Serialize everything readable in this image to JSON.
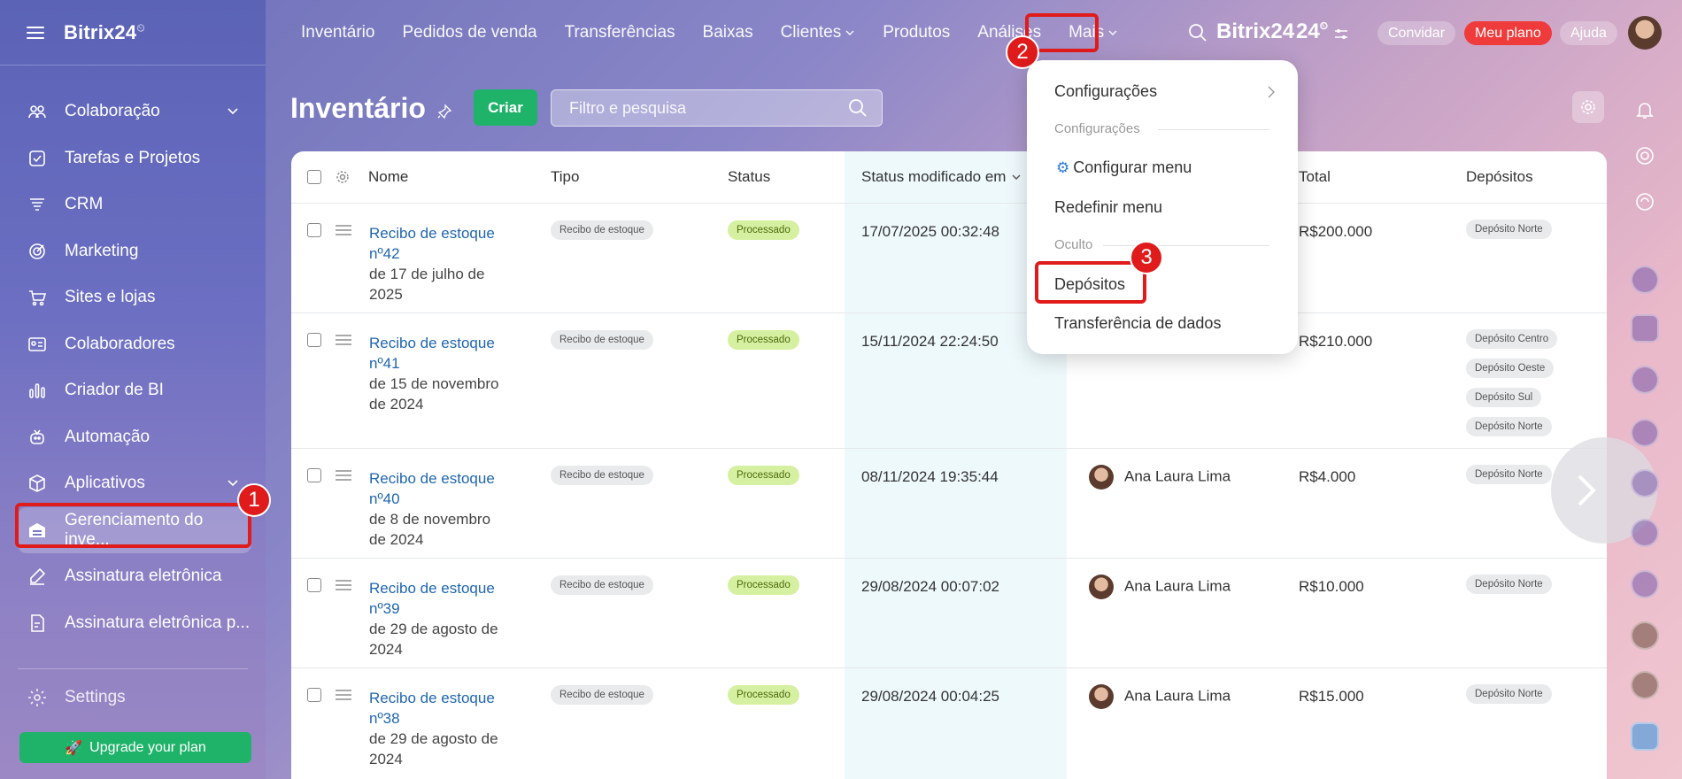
{
  "app": {
    "logo": "Bitrix24",
    "logo_mark": "⏲",
    "brand": "Bitrix24",
    "brand_num": "24"
  },
  "sidebar": {
    "items": [
      {
        "label": "Colaboração",
        "icon": "collaboration-icon",
        "chevron": true
      },
      {
        "label": "Tarefas e Projetos",
        "icon": "tasks-icon"
      },
      {
        "label": "CRM",
        "icon": "crm-icon"
      },
      {
        "label": "Marketing",
        "icon": "marketing-icon"
      },
      {
        "label": "Sites e lojas",
        "icon": "cart-icon"
      },
      {
        "label": "Colaboradores",
        "icon": "employees-icon"
      },
      {
        "label": "Criador de BI",
        "icon": "bi-chart-icon"
      },
      {
        "label": "Automação",
        "icon": "automation-icon"
      },
      {
        "label": "Aplicativos",
        "icon": "apps-icon",
        "chevron": true
      },
      {
        "label": "Gerenciamento do inve...",
        "icon": "inventory-icon"
      },
      {
        "label": "Assinatura eletrônica",
        "icon": "signature-icon"
      },
      {
        "label": "Assinatura eletrônica p...",
        "icon": "signature-doc-icon"
      }
    ],
    "settings_label": "Settings",
    "upgrade_label": "Upgrade your plan"
  },
  "topnav": {
    "items": [
      "Inventário",
      "Pedidos de venda",
      "Transferências",
      "Baixas",
      "Clientes",
      "Produtos",
      "Análises",
      "Mais"
    ],
    "invite": "Convidar",
    "plan": "Meu plano",
    "help": "Ajuda"
  },
  "annotations": {
    "one": "1",
    "two": "2",
    "three": "3"
  },
  "page": {
    "title": "Inventário",
    "create_button": "Criar",
    "search_placeholder": "Filtro e pesquisa"
  },
  "table": {
    "headers": [
      "Nome",
      "Tipo",
      "Status",
      "Status modificado em",
      "Total",
      "Depósitos"
    ],
    "rows": [
      {
        "title": "Recibo de estoque nº42",
        "title1": "Recibo de estoque",
        "title2": "nº42",
        "date1": "de 17 de julho de",
        "date2": "2025",
        "type": "Recibo de estoque",
        "status": "Processado",
        "modified": "17/07/2025 00:32:48",
        "person": "",
        "total": "R$200.000",
        "deposits": [
          "Depósito Norte"
        ]
      },
      {
        "title": "Recibo de estoque nº41",
        "title1": "Recibo de estoque",
        "title2": "nº41",
        "date1": "de 15 de novembro",
        "date2": "de 2024",
        "type": "Recibo de estoque",
        "status": "Processado",
        "modified": "15/11/2024 22:24:50",
        "person": "",
        "total": "R$210.000",
        "deposits": [
          "Depósito Centro",
          "Depósito Oeste",
          "Depósito Sul",
          "Depósito Norte"
        ]
      },
      {
        "title": "Recibo de estoque nº40",
        "title1": "Recibo de estoque",
        "title2": "nº40",
        "date1": "de 8 de novembro",
        "date2": "de 2024",
        "type": "Recibo de estoque",
        "status": "Processado",
        "modified": "08/11/2024 19:35:44",
        "person": "Ana Laura Lima",
        "total": "R$4.000",
        "deposits": [
          "Depósito Norte"
        ]
      },
      {
        "title": "Recibo de estoque nº39",
        "title1": "Recibo de estoque",
        "title2": "nº39",
        "date1": "de 29 de agosto de",
        "date2": "2024",
        "type": "Recibo de estoque",
        "status": "Processado",
        "modified": "29/08/2024 00:07:02",
        "person": "Ana Laura Lima",
        "total": "R$10.000",
        "deposits": [
          "Depósito Norte"
        ]
      },
      {
        "title": "Recibo de estoque nº38",
        "title1": "Recibo de estoque",
        "title2": "nº38",
        "date1": "de 29 de agosto de",
        "date2": "2024",
        "type": "Recibo de estoque",
        "status": "Processado",
        "modified": "29/08/2024 00:04:25",
        "person": "Ana Laura Lima",
        "total": "R$15.000",
        "deposits": [
          "Depósito Norte"
        ]
      }
    ]
  },
  "dropdown": {
    "configuracoes": "Configurações",
    "section_config": "Configurações",
    "configurar_menu": "Configurar menu",
    "redefinir_menu": "Redefinir menu",
    "section_hidden": "Oculto",
    "depositos": "Depósitos",
    "transferencia": "Transferência de dados"
  },
  "colors": {
    "accent_green": "#1fb36a",
    "highlight_red": "#e01b1b",
    "link_blue": "#2066b0"
  }
}
